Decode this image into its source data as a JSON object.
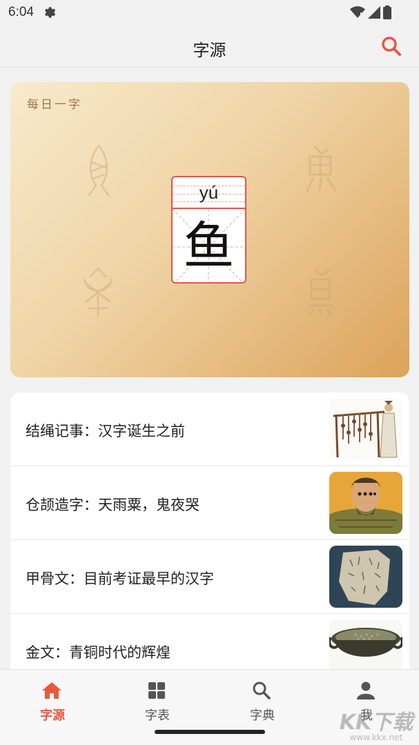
{
  "status_bar": {
    "time": "6:04"
  },
  "header": {
    "title": "字源"
  },
  "daily_card": {
    "label": "每日一字",
    "pinyin": "yú",
    "character": "鱼"
  },
  "articles": [
    {
      "title": "结绳记事：汉字诞生之前"
    },
    {
      "title": "仓颉造字：天雨粟，鬼夜哭"
    },
    {
      "title": "甲骨文：目前考证最早的汉字"
    },
    {
      "title": "金文：青铜时代的辉煌"
    }
  ],
  "bottom_nav": [
    {
      "label": "字源",
      "icon": "home-icon",
      "active": true
    },
    {
      "label": "字表",
      "icon": "grid-icon",
      "active": false
    },
    {
      "label": "字典",
      "icon": "search-icon",
      "active": false
    },
    {
      "label": "我",
      "icon": "person-icon",
      "active": false
    }
  ],
  "watermark": {
    "brand": "KK下载",
    "url": "www.kkx.net"
  },
  "colors": {
    "accent": "#e9573f",
    "card_gradient_start": "#f8eacc",
    "card_gradient_end": "#dca35a"
  }
}
